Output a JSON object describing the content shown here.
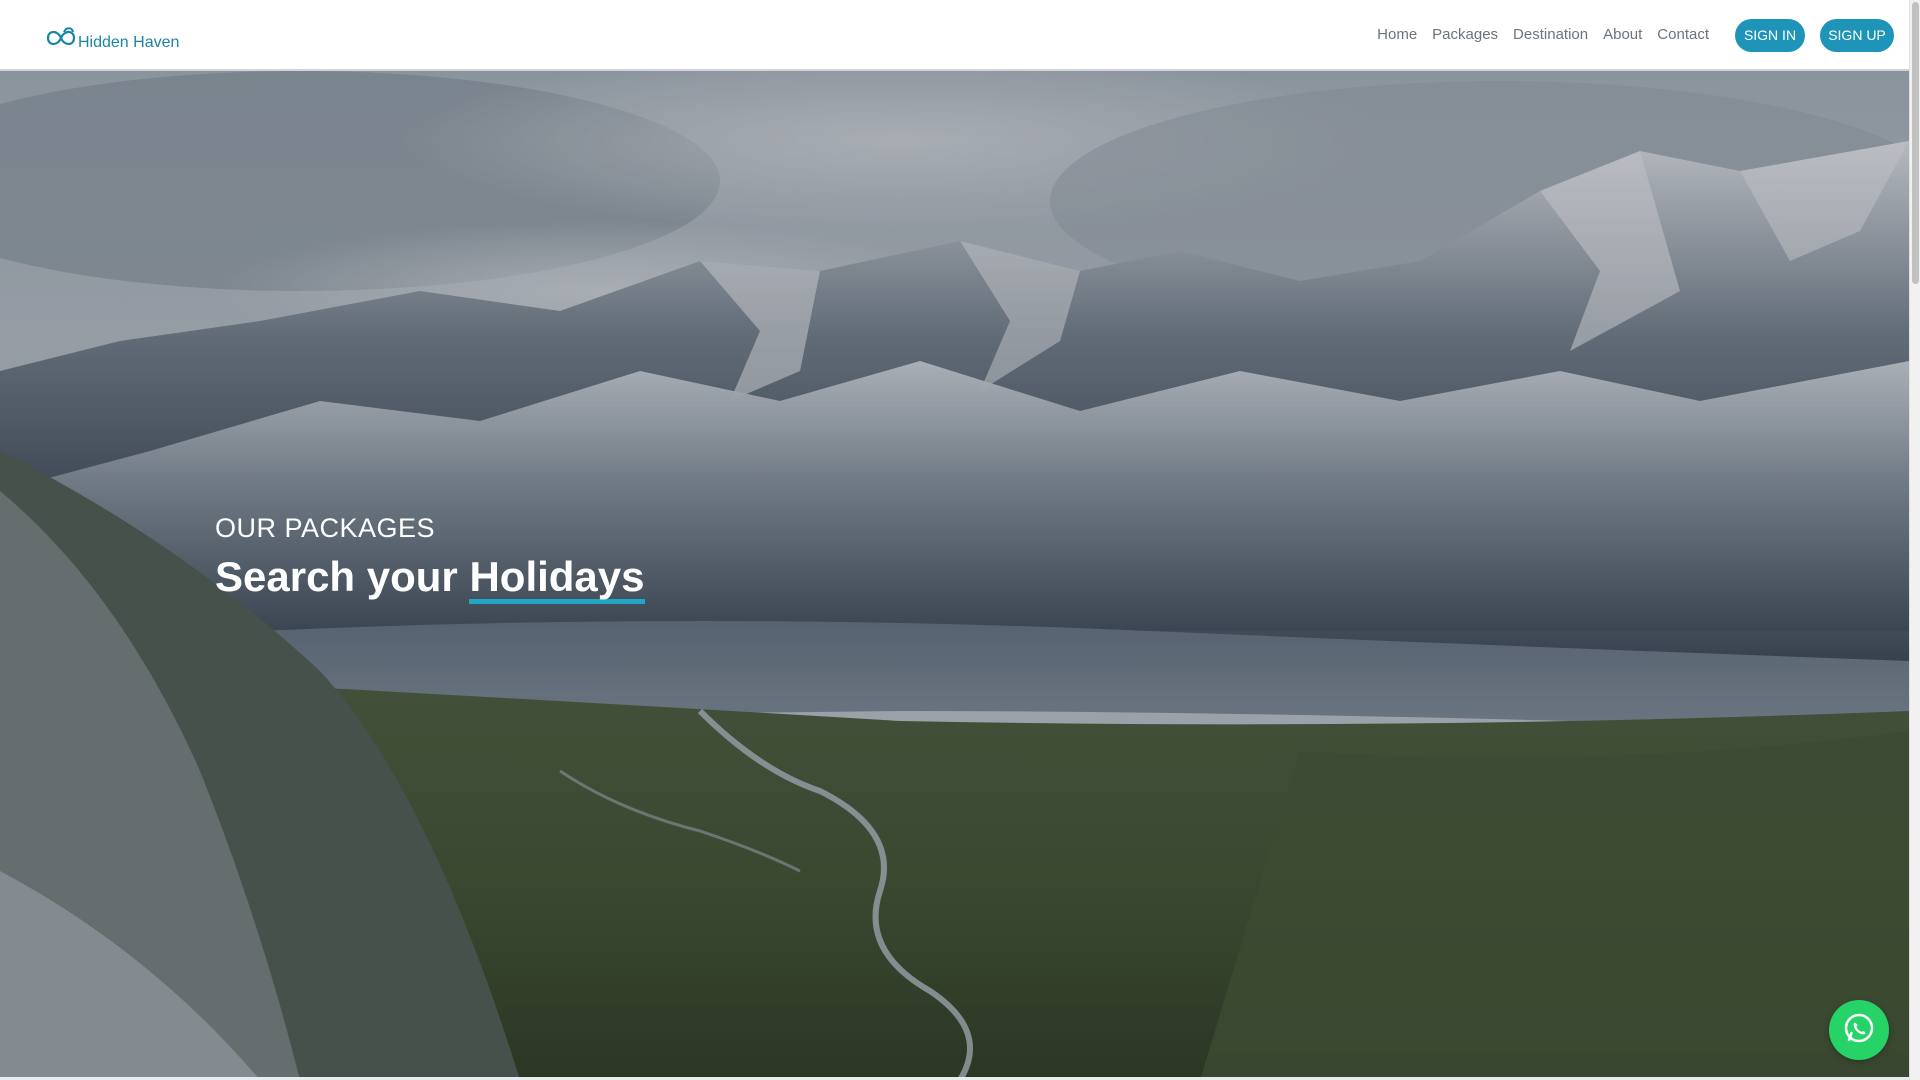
{
  "header": {
    "brand_name": "Hidden Haven",
    "brand_icon": "infinity-cloud-icon",
    "brand_color": "#1a86a3",
    "nav": [
      {
        "label": "Home"
      },
      {
        "label": "Packages"
      },
      {
        "label": "Destination"
      },
      {
        "label": "About"
      },
      {
        "label": "Contact"
      }
    ],
    "sign_in_label": "SIGN IN",
    "sign_up_label": "SIGN UP",
    "button_color": "#1e95b8"
  },
  "hero": {
    "eyebrow": "OUR PACKAGES",
    "title_prefix": "Search your ",
    "title_highlight": "Holidays",
    "accent_color": "#21a7c6",
    "background": "snow-capped mountain valley with river"
  },
  "floating": {
    "whatsapp_icon": "whatsapp-icon",
    "color": "#25d366"
  }
}
